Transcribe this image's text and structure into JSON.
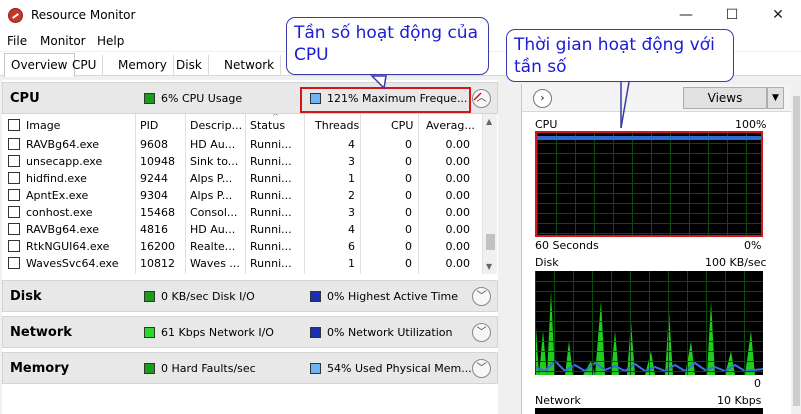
{
  "window": {
    "title": "Resource Monitor",
    "minimize": "—",
    "maximize": "☐",
    "close": "✕"
  },
  "menu": [
    "File",
    "Monitor",
    "Help"
  ],
  "tabs": [
    "Overview",
    "CPU",
    "Memory",
    "Disk",
    "Network"
  ],
  "cpu_section": {
    "title": "CPU",
    "usage": "6% CPU Usage",
    "frequency": "121% Maximum Freque...",
    "colors": {
      "usage": "#1a9c1a",
      "frequency": "#6fb3f2"
    },
    "columns": [
      "Image",
      "PID",
      "Descrip...",
      "Status",
      "Threads",
      "CPU",
      "Averag..."
    ],
    "rows": [
      [
        "RAVBg64.exe",
        "9608",
        "HD Au...",
        "Runni...",
        "4",
        "0",
        "0.00"
      ],
      [
        "unsecapp.exe",
        "10948",
        "Sink to...",
        "Runni...",
        "3",
        "0",
        "0.00"
      ],
      [
        "hidfind.exe",
        "9244",
        "Alps P...",
        "Runni...",
        "1",
        "0",
        "0.00"
      ],
      [
        "ApntEx.exe",
        "9304",
        "Alps P...",
        "Runni...",
        "2",
        "0",
        "0.00"
      ],
      [
        "conhost.exe",
        "15468",
        "Consol...",
        "Runni...",
        "3",
        "0",
        "0.00"
      ],
      [
        "RAVBg64.exe",
        "4816",
        "HD Au...",
        "Runni...",
        "4",
        "0",
        "0.00"
      ],
      [
        "RtkNGUI64.exe",
        "16200",
        "Realte...",
        "Runni...",
        "6",
        "0",
        "0.00"
      ],
      [
        "WavesSvc64.exe",
        "10812",
        "Waves ...",
        "Runni...",
        "1",
        "0",
        "0.00"
      ]
    ]
  },
  "disk_section": {
    "title": "Disk",
    "stat1": "0 KB/sec Disk I/O",
    "stat2": "0% Highest Active Time",
    "colors": {
      "stat1": "#1a9c1a",
      "stat2": "#1c2fb0"
    }
  },
  "network_section": {
    "title": "Network",
    "stat1": "61 Kbps Network I/O",
    "stat2": "0% Network Utilization",
    "colors": {
      "stat1": "#22dd22",
      "stat2": "#1c2fb0"
    }
  },
  "memory_section": {
    "title": "Memory",
    "stat1": "0 Hard Faults/sec",
    "stat2": "54% Used Physical Mem...",
    "colors": {
      "stat1": "#1a9c1a",
      "stat2": "#6fb3f2"
    }
  },
  "right_panel": {
    "views_label": "Views",
    "graphs": [
      {
        "name": "CPU",
        "max": "100%",
        "time": "60 Seconds",
        "min": "0%"
      },
      {
        "name": "Disk",
        "max": "100 KB/sec",
        "min": "0"
      },
      {
        "name": "Network",
        "max": "10 Kbps"
      }
    ]
  },
  "annotations": {
    "frequency_callout": "Tần số hoạt động của CPU",
    "time_callout": "Thời gian hoạt động với tần số"
  }
}
